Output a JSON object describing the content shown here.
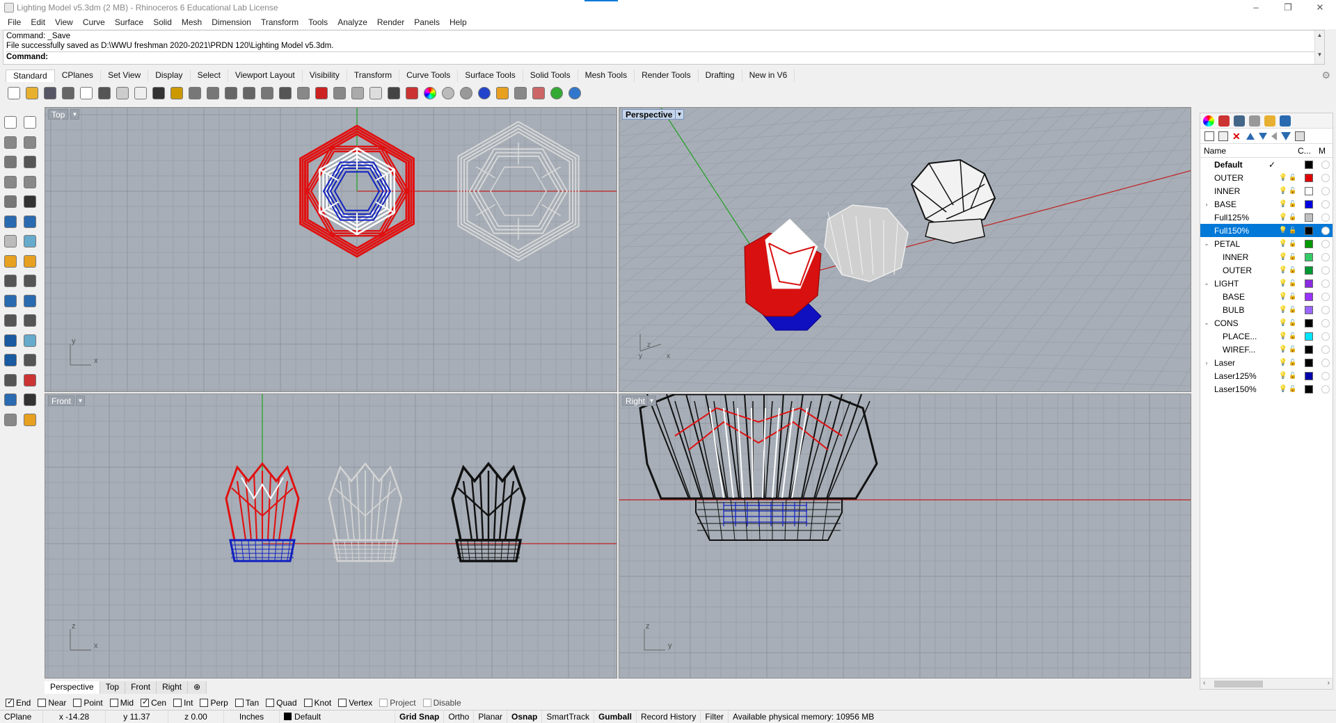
{
  "window": {
    "title": "Lighting Model v5.3dm (2 MB) - Rhinoceros 6 Educational Lab License",
    "minimize": "–",
    "restore": "❐",
    "close": "✕"
  },
  "menu": [
    "File",
    "Edit",
    "View",
    "Curve",
    "Surface",
    "Solid",
    "Mesh",
    "Dimension",
    "Transform",
    "Tools",
    "Analyze",
    "Render",
    "Panels",
    "Help"
  ],
  "command": {
    "line1": "Command: _Save",
    "line2": "File successfully saved as D:\\WWU freshman 2020-2021\\PRDN 120\\Lighting Model v5.3dm.",
    "prompt": "Command:"
  },
  "toolbar_tabs": [
    "Standard",
    "CPlanes",
    "Set View",
    "Display",
    "Select",
    "Viewport Layout",
    "Visibility",
    "Transform",
    "Curve Tools",
    "Surface Tools",
    "Solid Tools",
    "Mesh Tools",
    "Render Tools",
    "Drafting",
    "New in V6"
  ],
  "toolbar_icons": [
    "new-icon",
    "open-icon",
    "save-icon",
    "print-icon",
    "import-icon",
    "cut-icon",
    "copy-icon",
    "paste-icon",
    "undo-icon",
    "pan-icon",
    "move-view-icon",
    "zoom-icon",
    "zoom-window-icon",
    "zoom-extents-icon",
    "zoom-selected-icon",
    "rotate-view-icon",
    "four-viewports-icon",
    "car-icon",
    "cplane-icon",
    "named-view-icon",
    "light-icon",
    "lock-icon",
    "render-icon",
    "color-wheel-icon",
    "sphere-shaded-icon",
    "sphere-rendered-icon",
    "sphere-blue-icon",
    "pointer-icon",
    "zoom-text-icon",
    "cplane-axes-icon",
    "globe-icon",
    "help-icon"
  ],
  "viewports": {
    "top": {
      "label": "Top",
      "axis_a": "y",
      "axis_b": "x"
    },
    "perspective": {
      "label": "Perspective",
      "axis_a": "z",
      "axis_b": "y",
      "axis_c": "x"
    },
    "front": {
      "label": "Front",
      "axis_a": "z",
      "axis_b": "x"
    },
    "right": {
      "label": "Right",
      "axis_a": "z",
      "axis_b": "y"
    }
  },
  "viewport_tabs": [
    "Perspective",
    "Top",
    "Front",
    "Right"
  ],
  "viewport_tab_add": "⊕",
  "osnaps": [
    {
      "label": "End",
      "checked": true
    },
    {
      "label": "Near",
      "checked": false
    },
    {
      "label": "Point",
      "checked": false
    },
    {
      "label": "Mid",
      "checked": false
    },
    {
      "label": "Cen",
      "checked": true
    },
    {
      "label": "Int",
      "checked": false
    },
    {
      "label": "Perp",
      "checked": false
    },
    {
      "label": "Tan",
      "checked": false
    },
    {
      "label": "Quad",
      "checked": false
    },
    {
      "label": "Knot",
      "checked": false
    },
    {
      "label": "Vertex",
      "checked": false
    },
    {
      "label": "Project",
      "checked": false
    },
    {
      "label": "Disable",
      "checked": false
    }
  ],
  "status": {
    "cplane": "CPlane",
    "x": "x -14.28",
    "y": "y 11.37",
    "z": "z 0.00",
    "units": "Inches",
    "layer": "Default",
    "grid_snap": "Grid Snap",
    "ortho": "Ortho",
    "planar": "Planar",
    "osnap": "Osnap",
    "smarttrack": "SmartTrack",
    "gumball": "Gumball",
    "record_history": "Record History",
    "filter": "Filter",
    "memory": "Available physical memory: 10956 MB"
  },
  "layers_panel": {
    "columns": {
      "name": "Name",
      "color": "C...",
      "material": "M"
    },
    "layers": [
      {
        "name": "Default",
        "indent": 0,
        "expand": "",
        "current": true,
        "color": "#000000",
        "bold": true,
        "selected": false
      },
      {
        "name": "OUTER",
        "indent": 0,
        "expand": "",
        "current": false,
        "color": "#e00000",
        "bold": false,
        "selected": false
      },
      {
        "name": "INNER",
        "indent": 0,
        "expand": "",
        "current": false,
        "color": "#ffffff",
        "bold": false,
        "selected": false
      },
      {
        "name": "BASE",
        "indent": 0,
        "expand": "›",
        "current": false,
        "color": "#0000e0",
        "bold": false,
        "selected": false
      },
      {
        "name": "Full125%",
        "indent": 0,
        "expand": "",
        "current": false,
        "color": "#c0c0c0",
        "bold": false,
        "selected": false
      },
      {
        "name": "Full150%",
        "indent": 0,
        "expand": "",
        "current": false,
        "color": "#000000",
        "bold": false,
        "selected": true
      },
      {
        "name": "PETAL",
        "indent": 0,
        "expand": "⌄",
        "current": false,
        "color": "#009900",
        "bold": false,
        "selected": false
      },
      {
        "name": "INNER",
        "indent": 1,
        "expand": "",
        "current": false,
        "color": "#33cc66",
        "bold": false,
        "selected": false
      },
      {
        "name": "OUTER",
        "indent": 1,
        "expand": "",
        "current": false,
        "color": "#009933",
        "bold": false,
        "selected": false
      },
      {
        "name": "LIGHT",
        "indent": 0,
        "expand": "⌄",
        "current": false,
        "color": "#8a2be2",
        "bold": false,
        "selected": false
      },
      {
        "name": "BASE",
        "indent": 1,
        "expand": "",
        "current": false,
        "color": "#9933ff",
        "bold": false,
        "selected": false
      },
      {
        "name": "BULB",
        "indent": 1,
        "expand": "",
        "current": false,
        "color": "#9966ff",
        "bold": false,
        "selected": false
      },
      {
        "name": "CONS",
        "indent": 0,
        "expand": "⌄",
        "current": false,
        "color": "#000000",
        "bold": false,
        "selected": false
      },
      {
        "name": "PLACE...",
        "indent": 1,
        "expand": "",
        "current": false,
        "color": "#00e5ff",
        "bold": false,
        "selected": false
      },
      {
        "name": "WIREF...",
        "indent": 1,
        "expand": "",
        "current": false,
        "color": "#000000",
        "bold": false,
        "selected": false
      },
      {
        "name": "Laser",
        "indent": 0,
        "expand": "›",
        "current": false,
        "color": "#000000",
        "bold": false,
        "selected": false
      },
      {
        "name": "Laser125%",
        "indent": 0,
        "expand": "",
        "current": false,
        "color": "#0000aa",
        "bold": false,
        "selected": false
      },
      {
        "name": "Laser150%",
        "indent": 0,
        "expand": "",
        "current": false,
        "color": "#000000",
        "bold": false,
        "selected": false
      }
    ]
  }
}
